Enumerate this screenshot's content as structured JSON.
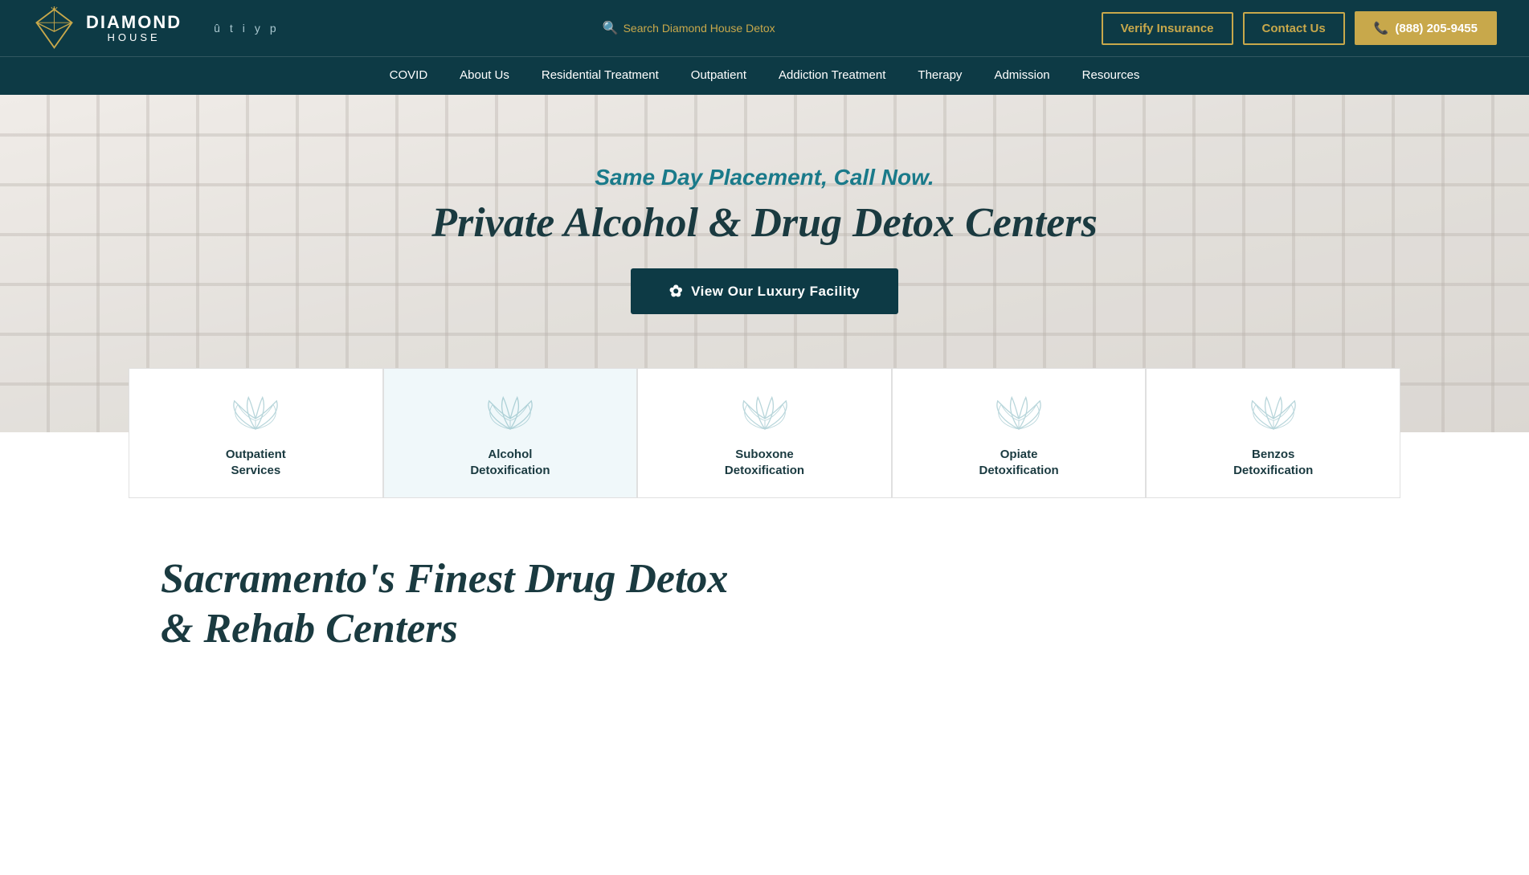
{
  "brand": {
    "name": "DIAMOND",
    "sub": "HOUSE",
    "tagline": "Same Day Placement, Call Now.",
    "hero_title": "Private Alcohol & Drug Detox Centers"
  },
  "header": {
    "search_placeholder": "Search Diamond House Detox",
    "search_label": "Search Diamond House Detox",
    "verify_insurance_label": "Verify Insurance",
    "contact_us_label": "Contact Us",
    "phone_label": "(888) 205-9455"
  },
  "social": {
    "icons": [
      "f",
      "t",
      "ig",
      "yt",
      "pin"
    ]
  },
  "nav": {
    "items": [
      {
        "label": "COVID",
        "id": "covid"
      },
      {
        "label": "About Us",
        "id": "about"
      },
      {
        "label": "Residential Treatment",
        "id": "residential"
      },
      {
        "label": "Outpatient",
        "id": "outpatient"
      },
      {
        "label": "Addiction Treatment",
        "id": "addiction"
      },
      {
        "label": "Therapy",
        "id": "therapy"
      },
      {
        "label": "Admission",
        "id": "admission"
      },
      {
        "label": "Resources",
        "id": "resources"
      }
    ]
  },
  "hero": {
    "cta_label": "View Our Luxury Facility"
  },
  "service_cards": [
    {
      "label": "Outpatient\nServices",
      "id": "outpatient-services"
    },
    {
      "label": "Alcohol\nDetoxification",
      "id": "alcohol-detox"
    },
    {
      "label": "Suboxone\nDetoxification",
      "id": "suboxone-detox"
    },
    {
      "label": "Opiate\nDetoxification",
      "id": "opiate-detox"
    },
    {
      "label": "Benzos\nDetoxification",
      "id": "benzos-detox"
    }
  ],
  "lower": {
    "title_line1": "Sacramento's Finest Drug Detox",
    "title_line2": "& Rehab Centers"
  },
  "colors": {
    "teal_dark": "#0d3a45",
    "gold": "#c8a84b",
    "teal_light": "#1a7a8a"
  }
}
